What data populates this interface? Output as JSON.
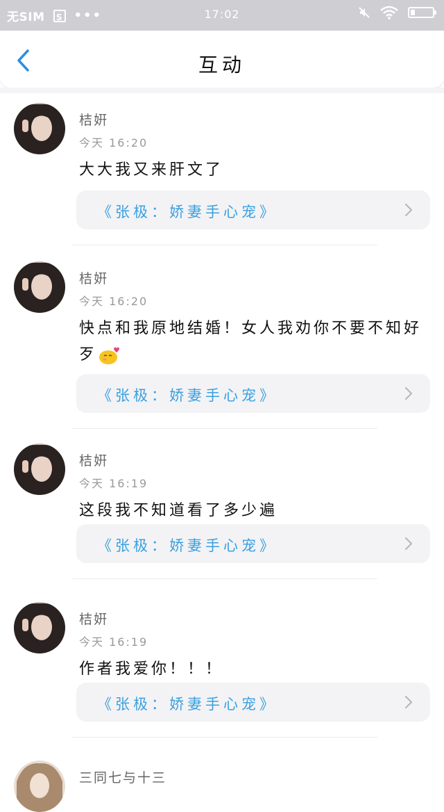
{
  "status_bar": {
    "carrier": "无SIM",
    "dots": "•••",
    "time": "17:02"
  },
  "nav": {
    "title": "互动"
  },
  "colors": {
    "accent": "#2b8fe0",
    "book_link": "#3aa0e0",
    "card_bg": "#f3f3f5"
  },
  "comments": [
    {
      "author": "桔姸",
      "time": "今天 16:20",
      "text": "大大我又来肝文了",
      "book": "《张极：娇妻手心宠》"
    },
    {
      "author": "桔姸",
      "time": "今天 16:20",
      "text": "快点和我原地结婚！女人我劝你不要不知好歹",
      "emoji": "blush-kiss-emoji",
      "book": "《张极：娇妻手心宠》"
    },
    {
      "author": "桔姸",
      "time": "今天 16:19",
      "text": "这段我不知道看了多少遍",
      "book": "《张极：娇妻手心宠》"
    },
    {
      "author": "桔姸",
      "time": "今天 16:19",
      "text": "作者我爱你！！！",
      "book": "《张极：娇妻手心宠》"
    },
    {
      "author": "三同七与十三"
    }
  ]
}
